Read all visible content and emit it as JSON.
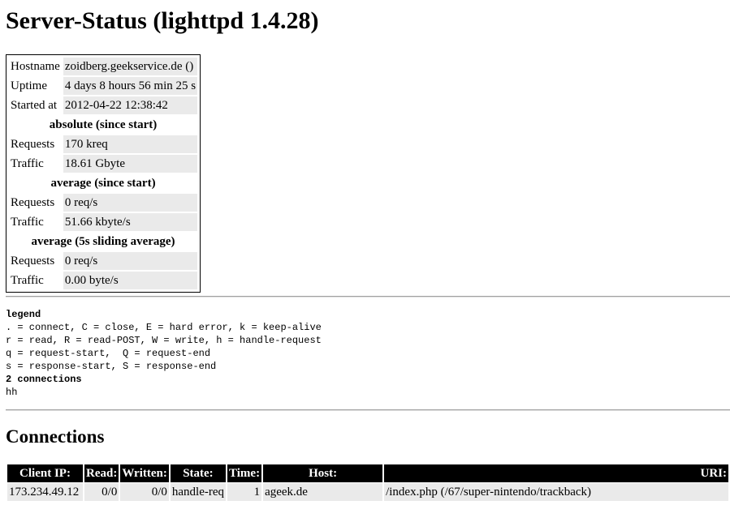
{
  "page_title": "Server-Status (lighttpd 1.4.28)",
  "status": {
    "hostname_label": "Hostname",
    "hostname_value": "zoidberg.geekservice.de ()",
    "uptime_label": "Uptime",
    "uptime_value": "4 days 8 hours 56 min 25 s",
    "started_label": "Started at",
    "started_value": "2012-04-22 12:38:42",
    "absolute_heading": "absolute (since start)",
    "abs_requests_label": "Requests",
    "abs_requests_value": "170 kreq",
    "abs_traffic_label": "Traffic",
    "abs_traffic_value": "18.61 Gbyte",
    "average_heading": "average (since start)",
    "avg_requests_label": "Requests",
    "avg_requests_value": "0 req/s",
    "avg_traffic_label": "Traffic",
    "avg_traffic_value": "51.66 kbyte/s",
    "sliding_heading": "average (5s sliding average)",
    "sld_requests_label": "Requests",
    "sld_requests_value": "0 req/s",
    "sld_traffic_label": "Traffic",
    "sld_traffic_value": "0.00 byte/s"
  },
  "legend": {
    "title": "legend",
    "line1": ". = connect, C = close, E = hard error, k = keep-alive",
    "line2": "r = read, R = read-POST, W = write, h = handle-request",
    "line3": "q = request-start,  Q = request-end",
    "line4": "s = response-start, S = response-end",
    "connections_count": "2 connections",
    "state_string": "hh"
  },
  "connections": {
    "heading": "Connections",
    "columns": {
      "client_ip": "Client IP:",
      "read": "Read:",
      "written": "Written:",
      "state": "State:",
      "time": "Time:",
      "host": "Host:",
      "uri": "URI:"
    },
    "rows": [
      {
        "client_ip": "173.234.49.12",
        "read": "0/0",
        "written": "0/0",
        "state": "handle-req",
        "time": "1",
        "host": "ageek.de",
        "uri": "/index.php (/67/super-nintendo/trackback)"
      }
    ]
  },
  "colors": {
    "header_bg": "#000000",
    "header_fg": "#ffffff",
    "value_bg": "#eaeaea"
  }
}
